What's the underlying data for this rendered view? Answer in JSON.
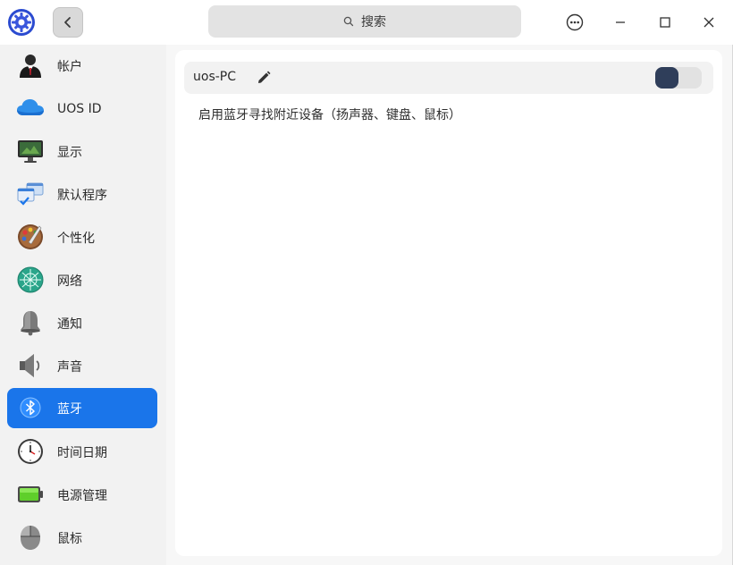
{
  "titlebar": {
    "search_placeholder": "搜索"
  },
  "sidebar": {
    "items": [
      {
        "label": "帐户",
        "icon": "account-icon"
      },
      {
        "label": "UOS ID",
        "icon": "cloud-icon"
      },
      {
        "label": "显示",
        "icon": "monitor-icon"
      },
      {
        "label": "默认程序",
        "icon": "default-apps-icon"
      },
      {
        "label": "个性化",
        "icon": "palette-icon"
      },
      {
        "label": "网络",
        "icon": "network-icon"
      },
      {
        "label": "通知",
        "icon": "bell-icon"
      },
      {
        "label": "声音",
        "icon": "speaker-icon"
      },
      {
        "label": "蓝牙",
        "icon": "bluetooth-icon",
        "active": true
      },
      {
        "label": "时间日期",
        "icon": "clock-icon"
      },
      {
        "label": "电源管理",
        "icon": "battery-icon"
      },
      {
        "label": "鼠标",
        "icon": "mouse-icon"
      }
    ]
  },
  "bluetooth": {
    "device_name": "uos-PC",
    "enabled": false,
    "hint": "启用蓝牙寻找附近设备（扬声器、键盘、鼠标）"
  },
  "colors": {
    "accent": "#1a75ea",
    "toggle_knob": "#2f3e5a"
  }
}
